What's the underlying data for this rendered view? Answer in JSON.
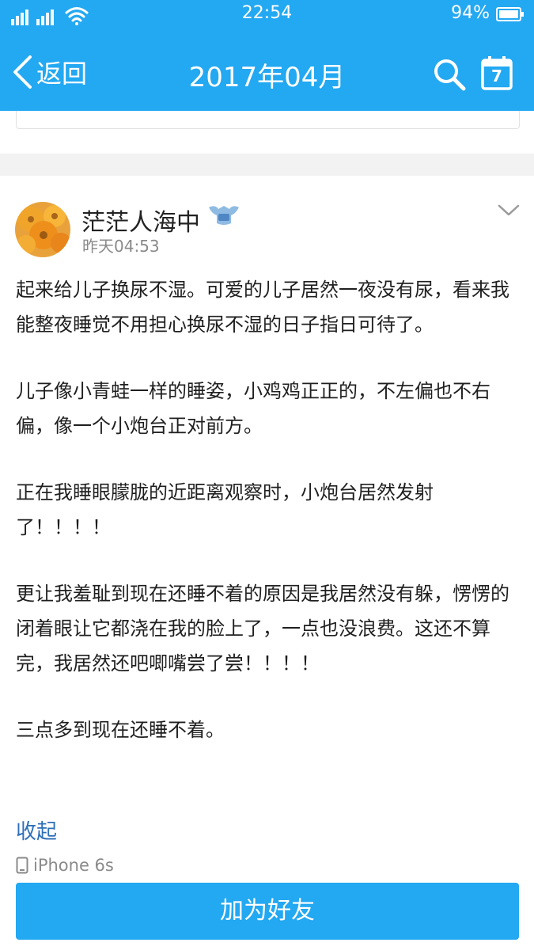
{
  "status_bar": {
    "time": "22:54",
    "battery": "94%"
  },
  "nav": {
    "back_label": "返回",
    "title": "2017年04月",
    "calendar_day": "7"
  },
  "post": {
    "author": "茫茫人海中",
    "time": "昨天04:53",
    "paragraphs": [
      "起来给儿子换尿不湿。可爱的儿子居然一夜没有尿，看来我能整夜睡觉不用担心换尿不湿的日子指日可待了。",
      "儿子像小青蛙一样的睡姿，小鸡鸡正正的，不左偏也不右偏，像一个小炮台正对前方。",
      "正在我睡眼朦胧的近距离观察时，小炮台居然发射了！！！！",
      "更让我羞耻到现在还睡不着的原因是我居然没有躲，愣愣的闭着眼让它都浇在我的脸上了，一点也没浪费。这还不算完，我居然还吧唧嘴尝了尝！！！！",
      "三点多到现在还睡不着。"
    ],
    "collapse_label": "收起",
    "device": "iPhone 6s"
  },
  "actions": {
    "add_friend_label": "加为好友"
  },
  "colors": {
    "accent": "#23a8f2",
    "link": "#2d6fb8",
    "muted": "#8a8a8a",
    "divider": "#f2f2f2"
  },
  "icons": {
    "back": "chevron-left-icon",
    "search": "search-icon",
    "calendar": "calendar-icon",
    "more": "chevron-down-icon",
    "badge": "vip-badge-icon",
    "device": "phone-icon"
  }
}
